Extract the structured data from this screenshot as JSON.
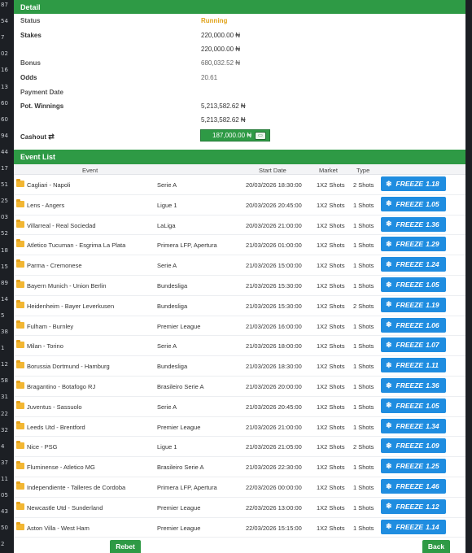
{
  "gutter": [
    "87",
    "54",
    "7",
    "02",
    "16",
    "13",
    "60",
    "60",
    "94",
    "44",
    "17",
    "51",
    "25",
    "03",
    "52",
    "18",
    "15",
    "89",
    "14",
    "5",
    "38",
    "1",
    "12",
    "58",
    "31",
    "22",
    "32",
    "4",
    "37",
    "11",
    "05",
    "43",
    "50",
    "2"
  ],
  "detail": {
    "title": "Detail",
    "status_label": "Status",
    "status_value": "Running",
    "stakes_label": "Stakes",
    "stakes_value_1": "220,000.00 ₦",
    "stakes_value_2": "220,000.00 ₦",
    "bonus_label": "Bonus",
    "bonus_value": "680,032.52 ₦",
    "odds_label": "Odds",
    "odds_value": "20.61",
    "payment_date_label": "Payment Date",
    "pot_winnings_label": "Pot. Winnings",
    "pot_winnings_value_1": "5,213,582.62 ₦",
    "pot_winnings_value_2": "5,213,582.62 ₦",
    "cashout_label": "Cashout",
    "cashout_icon": "refresh-icon",
    "cashout_amount": "187,000.00 ₦",
    "cashout_button_icon": "banknote-icon"
  },
  "events": {
    "title": "Event List",
    "columns": {
      "event": "Event",
      "start_date": "Start Date",
      "market": "Market",
      "type": "Type"
    },
    "freeze_label": "FREEZE",
    "rows": [
      {
        "event": "Cagliari - Napoli",
        "league": "Serie A",
        "date": "20/03/2026 18:30:00",
        "market": "1X2 Shots",
        "type": "2 Shots",
        "freeze": "1.18"
      },
      {
        "event": "Lens - Angers",
        "league": "Ligue 1",
        "date": "20/03/2026 20:45:00",
        "market": "1X2 Shots",
        "type": "1 Shots",
        "freeze": "1.05"
      },
      {
        "event": "Villarreal - Real Sociedad",
        "league": "LaLiga",
        "date": "20/03/2026 21:00:00",
        "market": "1X2 Shots",
        "type": "1 Shots",
        "freeze": "1.36"
      },
      {
        "event": "Atletico Tucuman - Esgrima La Plata",
        "league": "Primera LFP, Apertura",
        "date": "21/03/2026 01:00:00",
        "market": "1X2 Shots",
        "type": "1 Shots",
        "freeze": "1.29"
      },
      {
        "event": "Parma - Cremonese",
        "league": "Serie A",
        "date": "21/03/2026 15:00:00",
        "market": "1X2 Shots",
        "type": "1 Shots",
        "freeze": "1.24"
      },
      {
        "event": "Bayern Munich - Union Berlin",
        "league": "Bundesliga",
        "date": "21/03/2026 15:30:00",
        "market": "1X2 Shots",
        "type": "1 Shots",
        "freeze": "1.05"
      },
      {
        "event": "Heidenheim - Bayer Leverkusen",
        "league": "Bundesliga",
        "date": "21/03/2026 15:30:00",
        "market": "1X2 Shots",
        "type": "2 Shots",
        "freeze": "1.19"
      },
      {
        "event": "Fulham - Burnley",
        "league": "Premier League",
        "date": "21/03/2026 16:00:00",
        "market": "1X2 Shots",
        "type": "1 Shots",
        "freeze": "1.06"
      },
      {
        "event": "Milan - Torino",
        "league": "Serie A",
        "date": "21/03/2026 18:00:00",
        "market": "1X2 Shots",
        "type": "1 Shots",
        "freeze": "1.07"
      },
      {
        "event": "Borussia Dortmund - Hamburg",
        "league": "Bundesliga",
        "date": "21/03/2026 18:30:00",
        "market": "1X2 Shots",
        "type": "1 Shots",
        "freeze": "1.11"
      },
      {
        "event": "Bragantino - Botafogo RJ",
        "league": "Brasileiro Serie A",
        "date": "21/03/2026 20:00:00",
        "market": "1X2 Shots",
        "type": "1 Shots",
        "freeze": "1.36"
      },
      {
        "event": "Juventus - Sassuolo",
        "league": "Serie A",
        "date": "21/03/2026 20:45:00",
        "market": "1X2 Shots",
        "type": "1 Shots",
        "freeze": "1.05"
      },
      {
        "event": "Leeds Utd - Brentford",
        "league": "Premier League",
        "date": "21/03/2026 21:00:00",
        "market": "1X2 Shots",
        "type": "1 Shots",
        "freeze": "1.34"
      },
      {
        "event": "Nice - PSG",
        "league": "Ligue 1",
        "date": "21/03/2026 21:05:00",
        "market": "1X2 Shots",
        "type": "2 Shots",
        "freeze": "1.09"
      },
      {
        "event": "Fluminense - Atletico MG",
        "league": "Brasileiro Serie A",
        "date": "21/03/2026 22:30:00",
        "market": "1X2 Shots",
        "type": "1 Shots",
        "freeze": "1.25"
      },
      {
        "event": "Independiente - Talleres de Cordoba",
        "league": "Primera LFP, Apertura",
        "date": "22/03/2026 00:00:00",
        "market": "1X2 Shots",
        "type": "1 Shots",
        "freeze": "1.46"
      },
      {
        "event": "Newcastle Utd - Sunderland",
        "league": "Premier League",
        "date": "22/03/2026 13:00:00",
        "market": "1X2 Shots",
        "type": "1 Shots",
        "freeze": "1.12"
      },
      {
        "event": "Aston Villa - West Ham",
        "league": "Premier League",
        "date": "22/03/2026 15:15:00",
        "market": "1X2 Shots",
        "type": "1 Shots",
        "freeze": "1.14"
      }
    ]
  },
  "footer": {
    "rebet_label": "Rebet",
    "back_label": "Back"
  },
  "colors": {
    "header_green": "#2e9a45",
    "freeze_blue": "#1f8de0",
    "running_orange": "#e0a21a"
  }
}
